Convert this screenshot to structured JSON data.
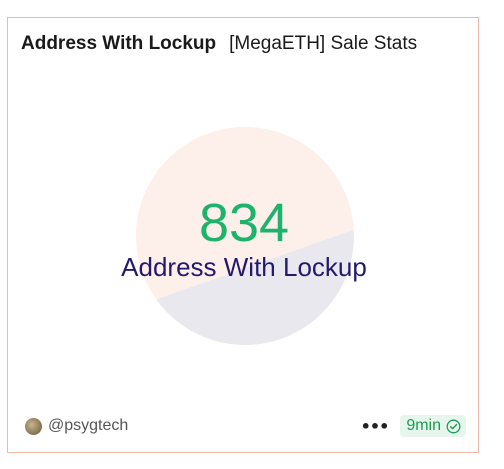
{
  "header": {
    "title": "Address With Lockup",
    "subtitle": "[MegaETH] Sale Stats"
  },
  "stat": {
    "value": "834",
    "label": "Address With Lockup",
    "value_color": "#1db36a",
    "label_color": "#231a6e"
  },
  "background_disc": {
    "colors": [
      "#fdefe9",
      "#e8e8ee"
    ]
  },
  "footer": {
    "author": "@psygtech",
    "more_icon": "more-horizontal-icon",
    "refresh_label": "9min",
    "refresh_icon": "check-circle-icon",
    "accent": "#1d9a55"
  },
  "card": {
    "border_color": "#f0b8a8"
  }
}
